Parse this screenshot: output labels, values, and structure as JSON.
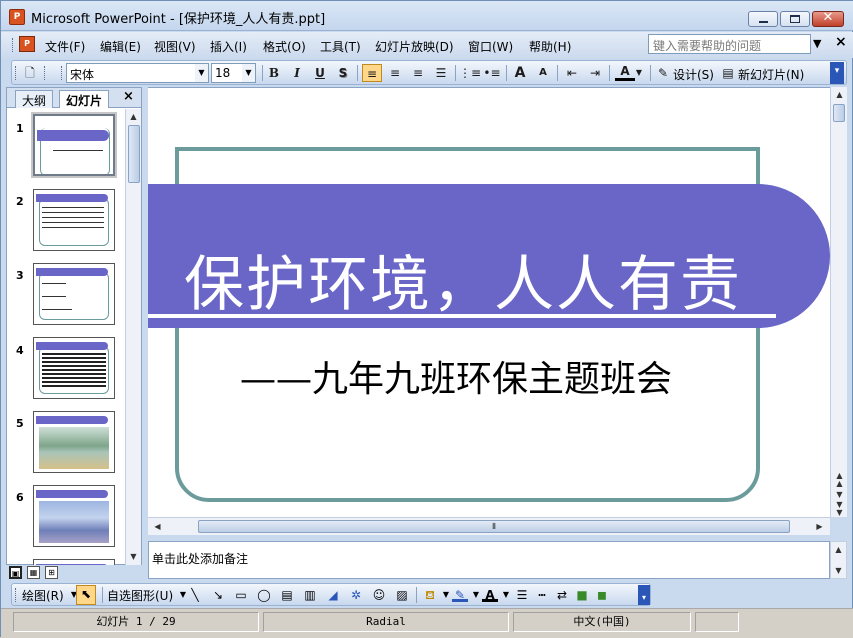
{
  "window": {
    "app_icon": "P",
    "title": "Microsoft PowerPoint - [保护环境_人人有责.ppt]",
    "close_glyph": "✕"
  },
  "menubar": {
    "items": [
      "文件(F)",
      "编辑(E)",
      "视图(V)",
      "插入(I)",
      "格式(O)",
      "工具(T)",
      "幻灯片放映(D)",
      "窗口(W)",
      "帮助(H)"
    ],
    "help_placeholder": "键入需要帮助的问题",
    "doc_close": "×"
  },
  "toolbar": {
    "font_name": "宋体",
    "font_size": "18",
    "bold": "B",
    "italic": "I",
    "underline": "U",
    "shadow": "S",
    "grow_font": "A",
    "shrink_font": "A",
    "font_color": "A",
    "design_label": "设计(S)",
    "new_slide_label": "新幻灯片(N)"
  },
  "leftpane": {
    "tabs": [
      "大纲",
      "幻灯片"
    ],
    "close": "×",
    "slide_numbers": [
      "1",
      "2",
      "3",
      "4",
      "5",
      "6"
    ]
  },
  "slide": {
    "title": "保护环境，人人有责",
    "subtitle": "——九年九班环保主题班会",
    "banner_color": "#6966c8",
    "frame_color": "#6c9b9c"
  },
  "notes": {
    "placeholder": "单击此处添加备注"
  },
  "drawbar": {
    "draw_label": "绘图(R)",
    "autoshape_label": "自选图形(U)"
  },
  "statusbar": {
    "slide_info": "幻灯片 1 / 29",
    "design_name": "Radial",
    "language": "中文(中国)"
  }
}
